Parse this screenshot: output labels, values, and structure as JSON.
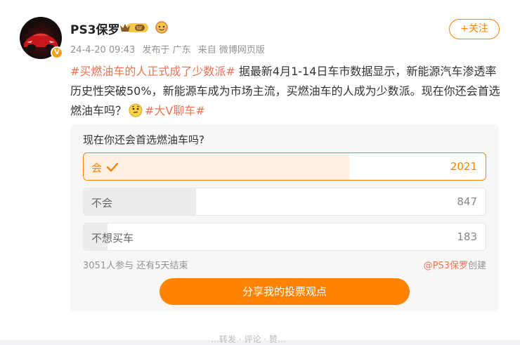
{
  "header": {
    "username": "PS3保罗",
    "verified_badge_letter": "V",
    "follow_label": "+关注",
    "meta": {
      "time": "24-4-20 09:43",
      "location": "发布于 广东",
      "source": "来自 微博网页版"
    }
  },
  "post": {
    "hashtag_1": "#买燃油车的人正式成了少数派#",
    "body": " 据最新4月1-14日车市数据显示，新能源汽车渗透率历史性突破50%，新能源车成为市场主流，买燃油车的人成为少数派。现在你还会首选燃油车吗？",
    "hashtag_2": "#大V聊车#"
  },
  "poll": {
    "question": "现在你还会首选燃油车吗?",
    "options": [
      {
        "label": "会",
        "count": "2021",
        "share": 0.66,
        "selected": true
      },
      {
        "label": "不会",
        "count": "847",
        "share": 0.28,
        "selected": false
      },
      {
        "label": "不想买车",
        "count": "183",
        "share": 0.06,
        "selected": false
      }
    ],
    "stats": "3051人参与 还有5天结束",
    "creator_mention": "@PS3保罗",
    "creator_suffix": "创建",
    "share_label": "分享我的投票观点"
  },
  "footer_hint": "…转发 · 评论 · 赞…",
  "colors": {
    "accent": "#ff8200",
    "hashtag": "#eb7350",
    "muted": "#939393"
  },
  "icons": [
    "avatar-car-icon",
    "crown-level-badge-icon",
    "face-badge-icon",
    "thinking-emoji-icon",
    "checkmark-icon"
  ]
}
